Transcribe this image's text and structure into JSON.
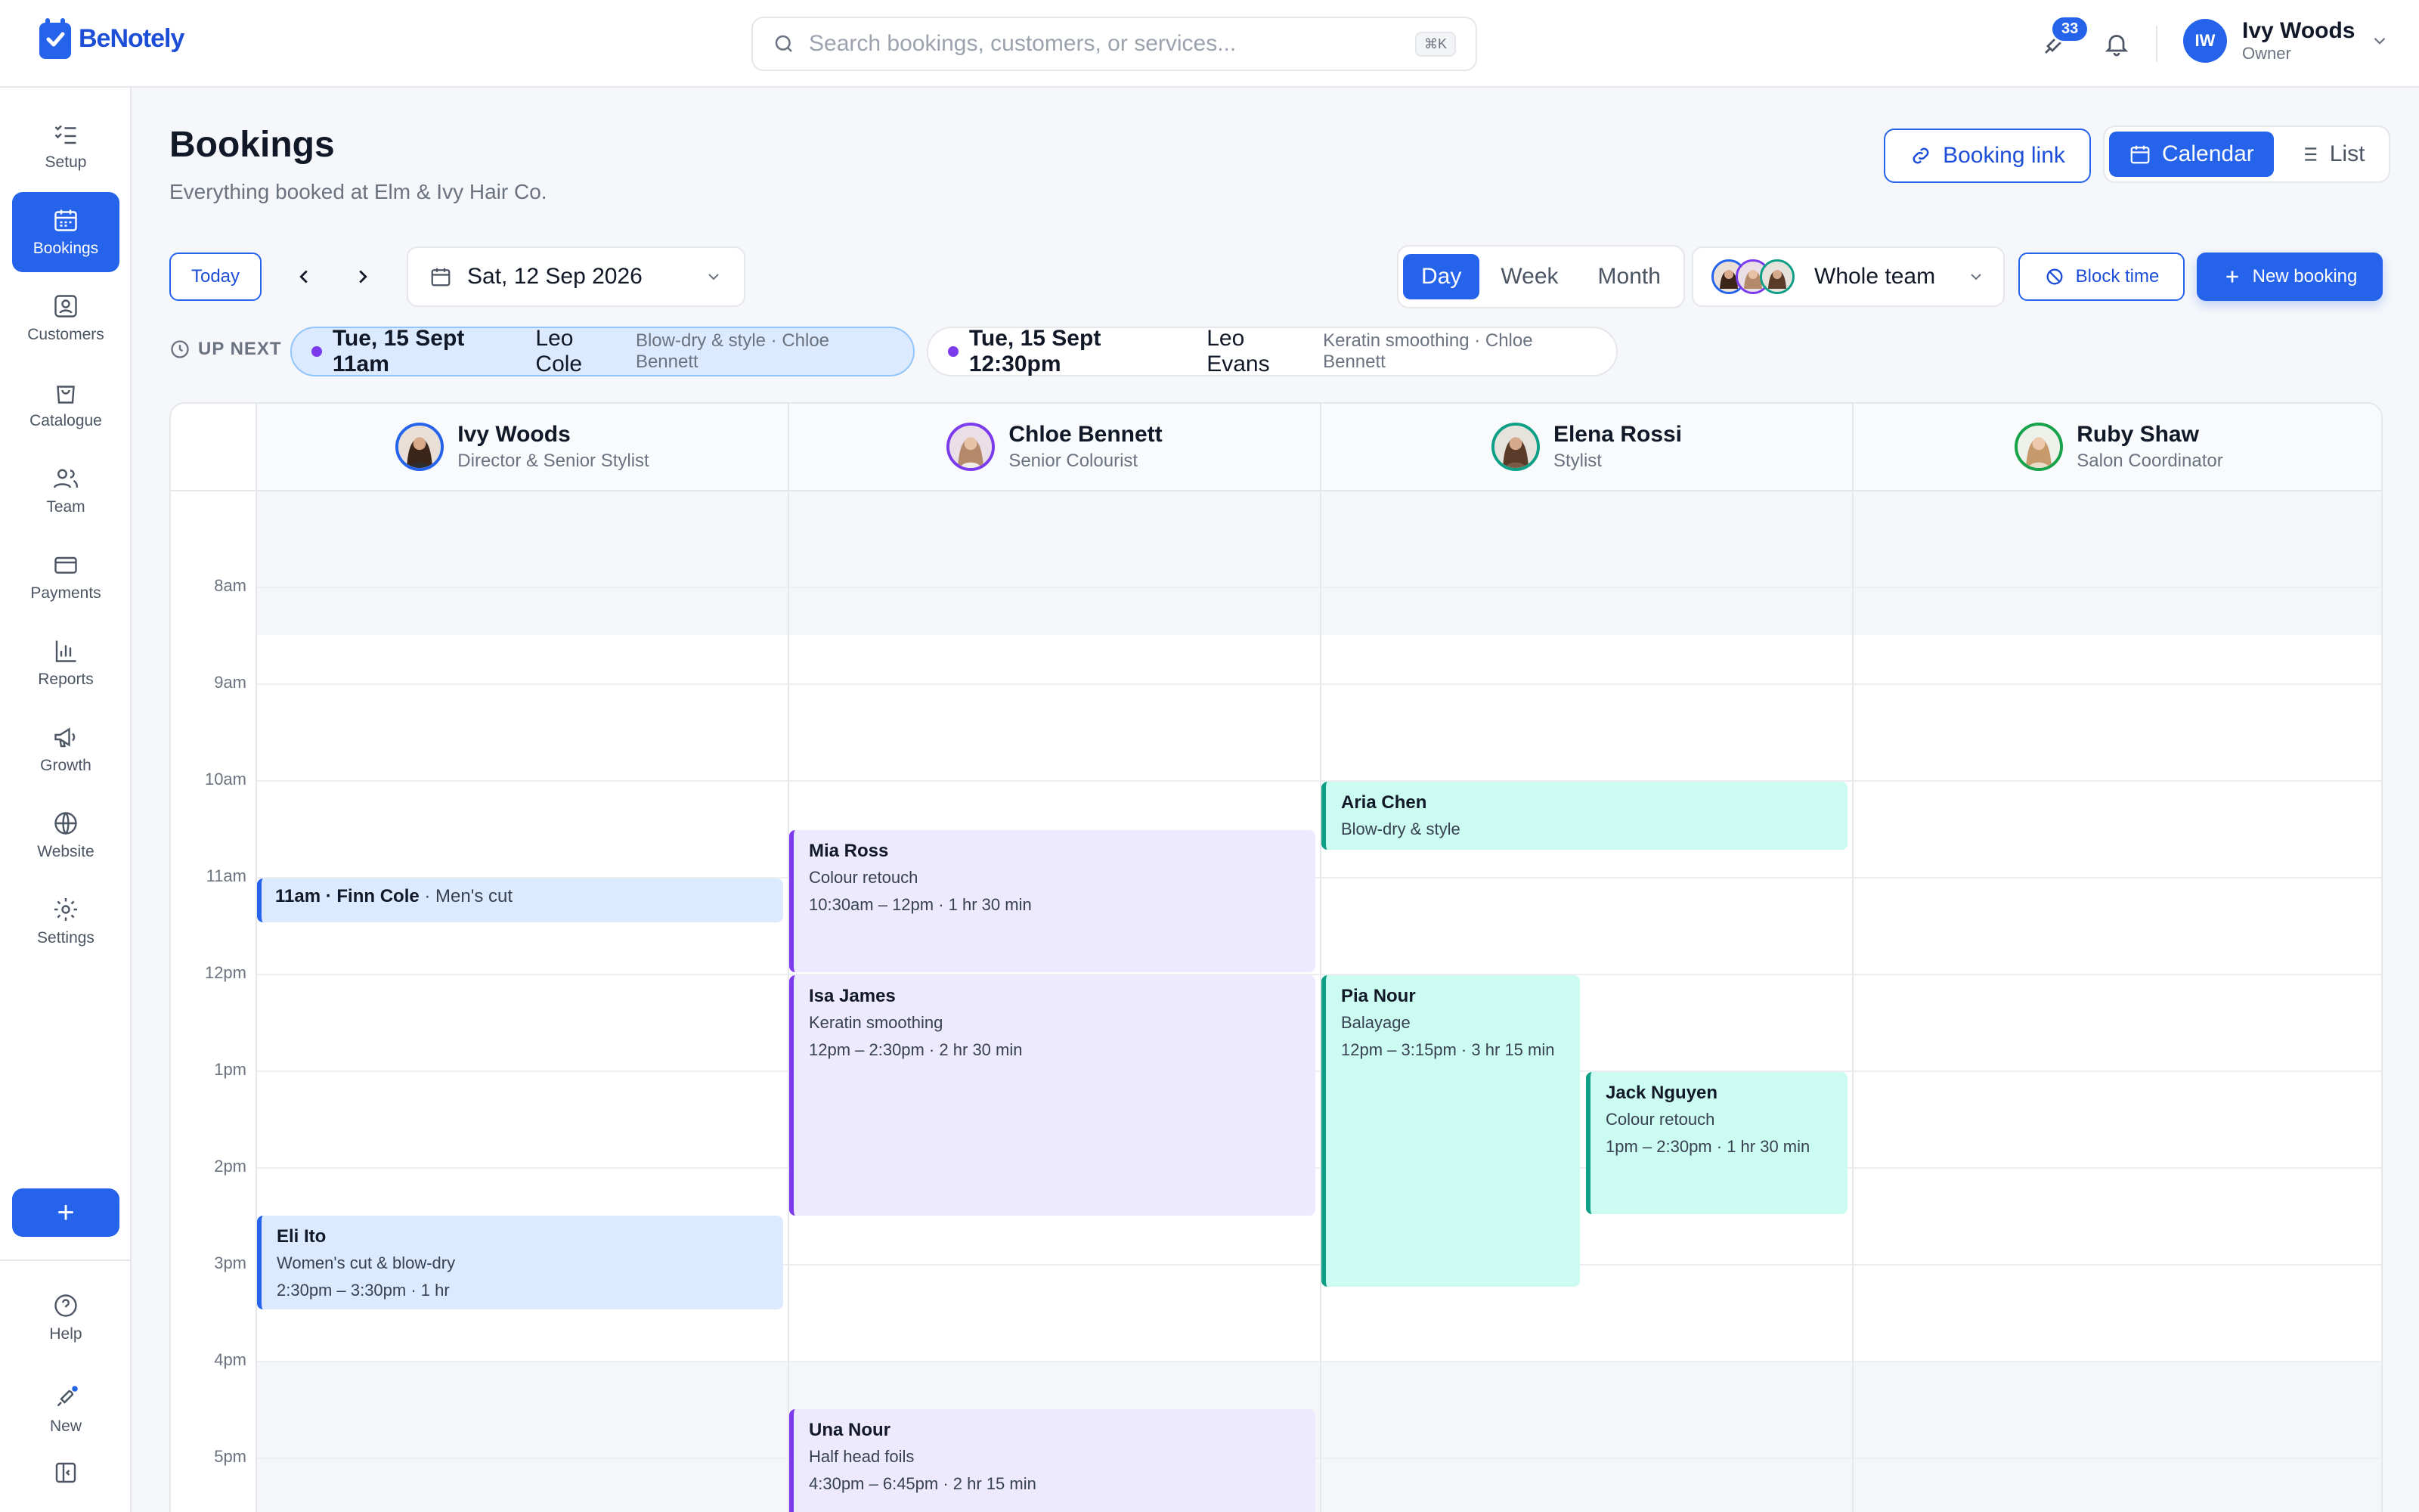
{
  "app": {
    "name": "BeNotely"
  },
  "search": {
    "placeholder": "Search bookings, customers, or services...",
    "shortcut": "⌘K"
  },
  "header": {
    "notification_count": "33"
  },
  "user": {
    "initials": "IW",
    "name": "Ivy Woods",
    "role": "Owner"
  },
  "sidebar": {
    "items": [
      {
        "label": "Setup",
        "icon": "checklist-icon"
      },
      {
        "label": "Bookings",
        "icon": "calendar-icon",
        "active": true
      },
      {
        "label": "Customers",
        "icon": "customer-icon"
      },
      {
        "label": "Catalogue",
        "icon": "bag-icon"
      },
      {
        "label": "Team",
        "icon": "team-icon"
      },
      {
        "label": "Payments",
        "icon": "card-icon"
      },
      {
        "label": "Reports",
        "icon": "chart-icon"
      },
      {
        "label": "Growth",
        "icon": "megaphone-icon"
      },
      {
        "label": "Website",
        "icon": "globe-icon"
      },
      {
        "label": "Settings",
        "icon": "gear-icon"
      }
    ],
    "add_label": "+",
    "help_label": "Help",
    "new_label": "New"
  },
  "page": {
    "title": "Bookings",
    "subtitle": "Everything booked at Elm & Ivy Hair Co."
  },
  "actions": {
    "booking_link": "Booking link",
    "calendar": "Calendar",
    "list": "List",
    "block_time": "Block time",
    "new_booking": "New booking"
  },
  "toolbar": {
    "today": "Today",
    "date": "Sat, 12 Sep 2026",
    "views": [
      "Day",
      "Week",
      "Month"
    ],
    "active_view": "Day",
    "team_filter": "Whole team"
  },
  "up_next": {
    "label": "UP NEXT",
    "items": [
      {
        "time": "Tue, 15 Sept 11am",
        "customer": "Leo Cole",
        "meta": "Blow-dry & style · Chloe Bennett"
      },
      {
        "time": "Tue, 15 Sept 12:30pm",
        "customer": "Leo Evans",
        "meta": "Keratin smoothing · Chloe Bennett"
      }
    ]
  },
  "calendar": {
    "staff": [
      {
        "name": "Ivy Woods",
        "role": "Director & Senior Stylist",
        "ring": "#2563eb"
      },
      {
        "name": "Chloe Bennett",
        "role": "Senior Colourist",
        "ring": "#7c3aed"
      },
      {
        "name": "Elena Rossi",
        "role": "Stylist",
        "ring": "#0f9f86"
      },
      {
        "name": "Ruby Shaw",
        "role": "Salon Coordinator",
        "ring": "#16a34a"
      }
    ],
    "hours": [
      "8am",
      "9am",
      "10am",
      "11am",
      "12pm",
      "1pm",
      "2pm",
      "3pm",
      "4pm",
      "5pm"
    ],
    "events": {
      "finn": {
        "time": "11am · ",
        "name": "Finn Cole",
        "service": " · Men's cut"
      },
      "eli": {
        "name": "Eli Ito",
        "service": "Women's cut & blow-dry",
        "time": "2:30pm – 3:30pm · 1 hr"
      },
      "mia": {
        "name": "Mia Ross",
        "service": "Colour retouch",
        "time": "10:30am – 12pm · 1 hr 30 min"
      },
      "isa": {
        "name": "Isa James",
        "service": "Keratin smoothing",
        "time": "12pm – 2:30pm · 2 hr 30 min"
      },
      "una": {
        "name": "Una Nour",
        "service": "Half head foils",
        "time": "4:30pm – 6:45pm · 2 hr 15 min"
      },
      "aria": {
        "name": "Aria Chen",
        "service": "Blow-dry & style"
      },
      "pia": {
        "name": "Pia Nour",
        "service": "Balayage",
        "time": "12pm – 3:15pm · 3 hr 15 min"
      },
      "jack": {
        "name": "Jack Nguyen",
        "service": "Colour retouch",
        "time": "1pm – 2:30pm · 1 hr 30 min"
      }
    }
  },
  "colors": {
    "accent": "#2563eb",
    "purple": "#7c3aed",
    "teal": "#0f9f86"
  }
}
